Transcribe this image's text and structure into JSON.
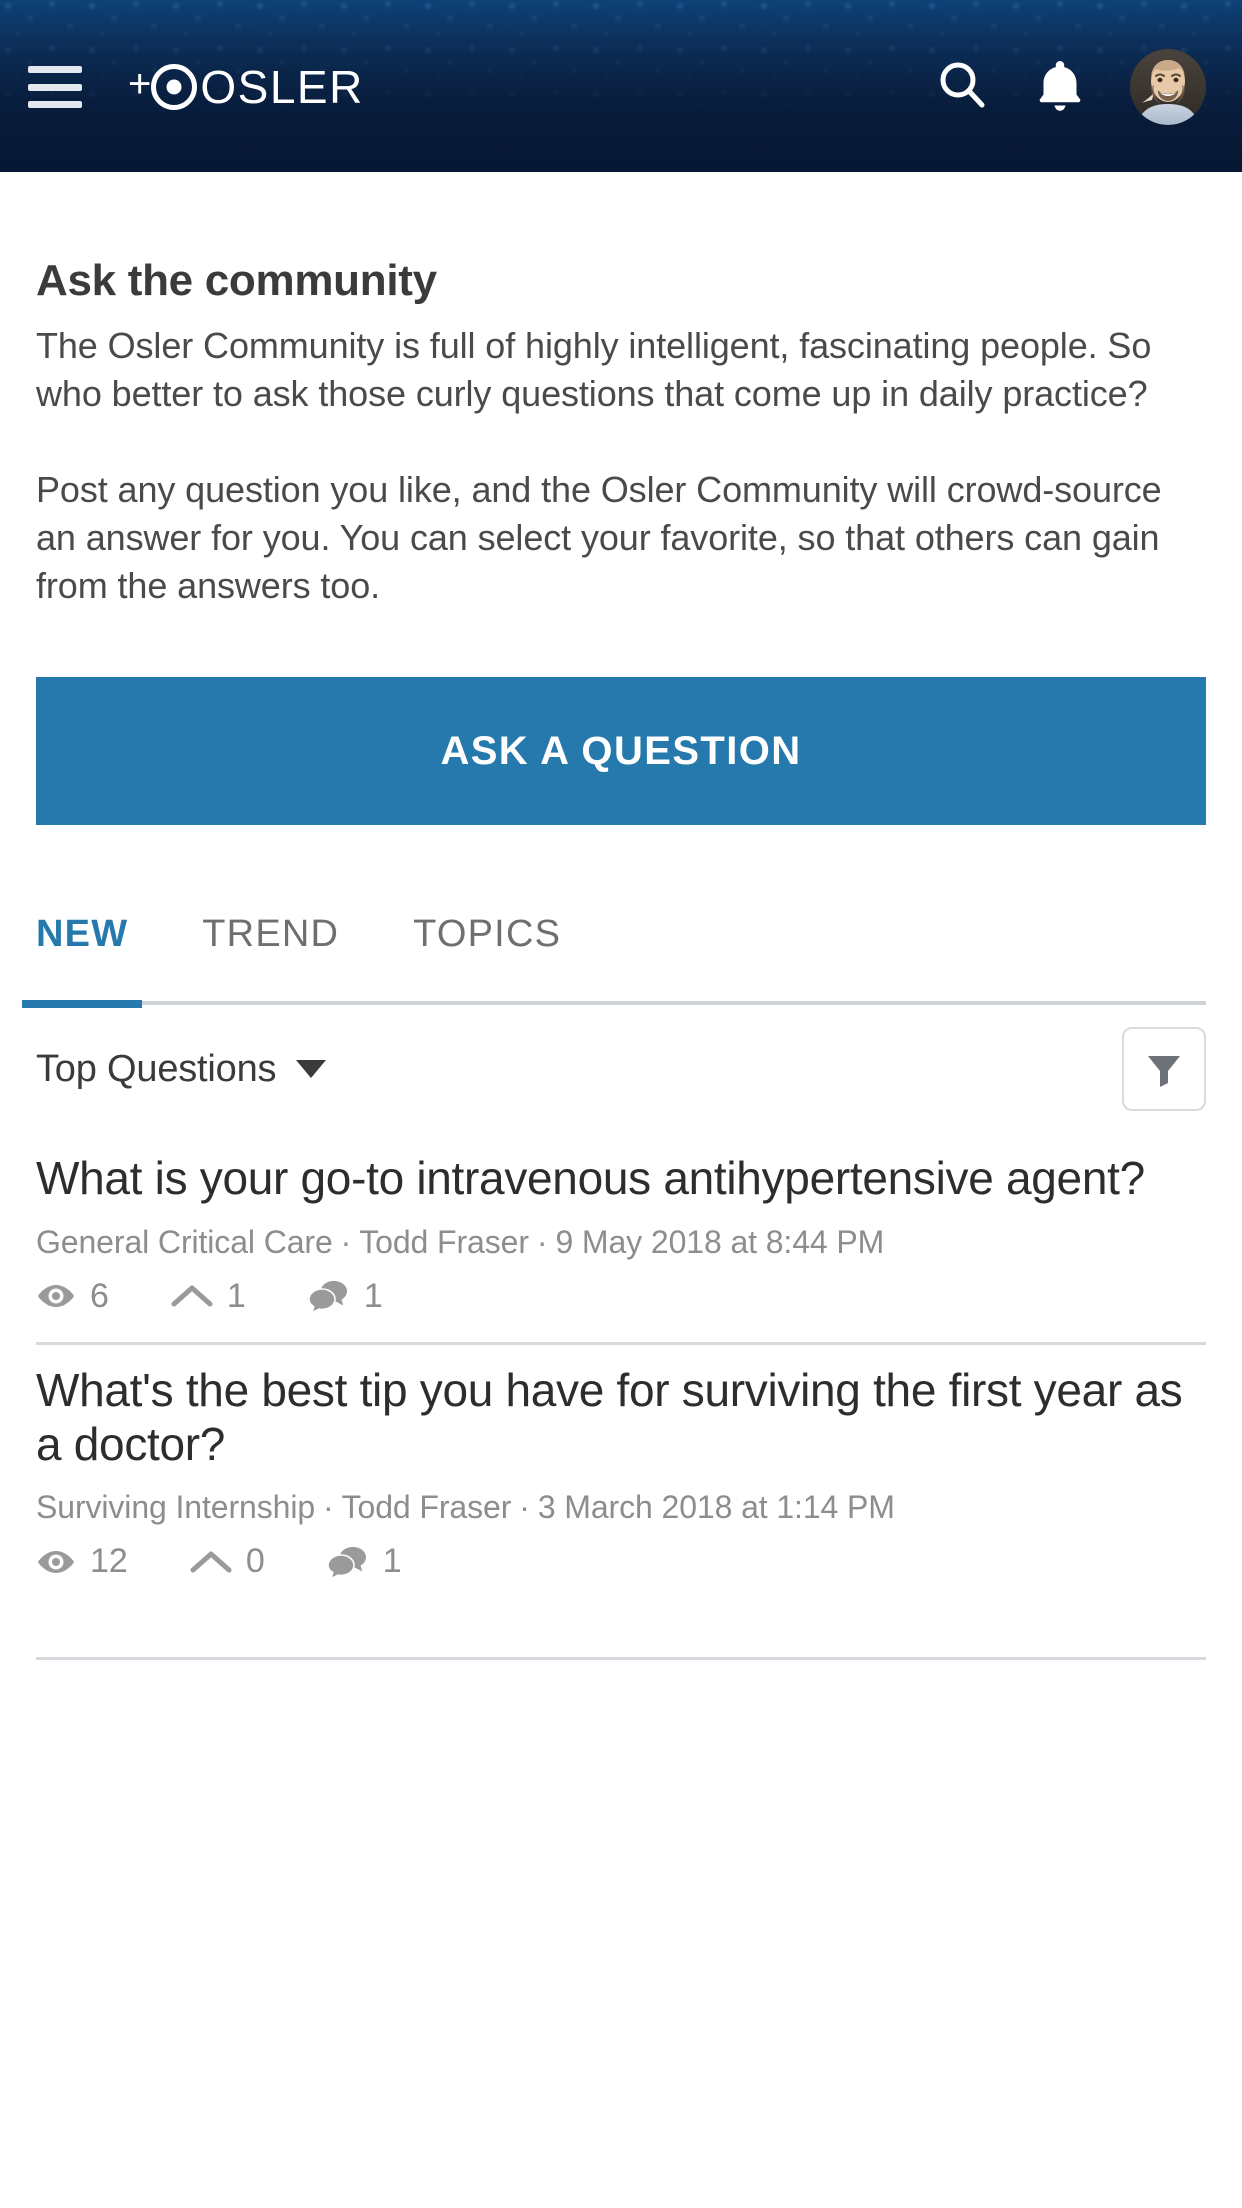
{
  "header": {
    "menu_icon": "hamburger-menu-icon",
    "brand_plus": "+",
    "brand_word": "OSLER",
    "search_icon": "search-icon",
    "notifications_icon": "bell-icon",
    "avatar_alt": "user-avatar"
  },
  "main": {
    "title": "Ask the community",
    "paragraph_1": "The Osler Community is full of highly intelligent, fascinating people.  So who better to ask those curly questions that come up in daily practice?",
    "paragraph_2": "Post any question you like, and the Osler Community will crowd-source an answer for you.  You can select your favorite, so that others can gain from the answers too.",
    "ask_button_label": "ASK A QUESTION"
  },
  "tabs": [
    {
      "label": "NEW",
      "active": true
    },
    {
      "label": "TREND",
      "active": false
    },
    {
      "label": "TOPICS",
      "active": false
    }
  ],
  "list_controls": {
    "sort_label": "Top Questions",
    "sort_caret_icon": "chevron-down-icon",
    "filter_icon": "filter-funnel-icon"
  },
  "questions": [
    {
      "title": "What is your go-to intravenous antihypertensive agent?",
      "topic": "General Critical Care",
      "author": "Todd Fraser",
      "timestamp": "9 May 2018 at 8:44 PM",
      "separator": "·",
      "views_icon": "eye-icon",
      "views": "6",
      "votes_icon": "upvote-chevron-icon",
      "votes": "1",
      "comments_icon": "comment-bubbles-icon",
      "comments": "1"
    },
    {
      "title": "What's the best tip you have for surviving the first year as a doctor?",
      "topic": "Surviving Internship",
      "author": "Todd Fraser",
      "timestamp": "3 March 2018 at 1:14 PM",
      "separator": "·",
      "views_icon": "eye-icon",
      "views": "12",
      "votes_icon": "upvote-chevron-icon",
      "votes": "0",
      "comments_icon": "comment-bubbles-icon",
      "comments": "1"
    }
  ],
  "colors": {
    "header_navy": "#07182f",
    "header_blue": "#0d4278",
    "accent_blue": "#2579ad",
    "text_dark": "#2d2d2d",
    "text_muted": "#8d8d8d",
    "rule": "#d6d9dd"
  }
}
